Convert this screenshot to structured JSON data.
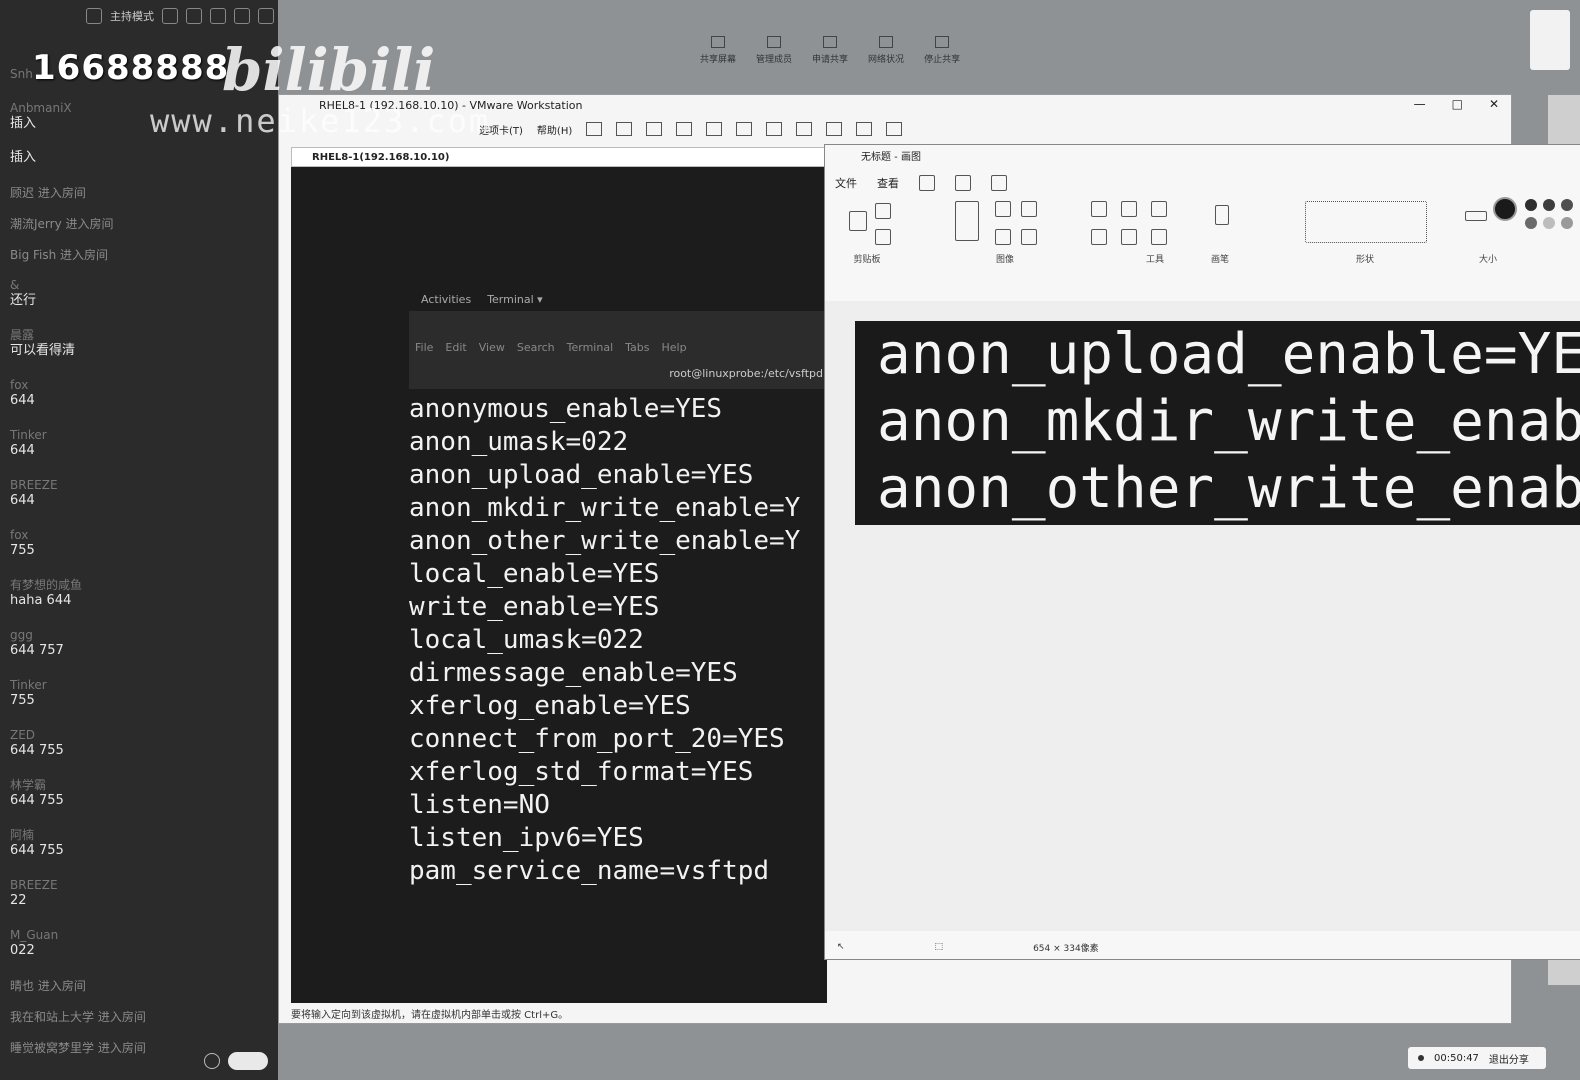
{
  "chat": {
    "top_label": "主持模式",
    "watermark_number": "16688888",
    "watermark_logo": "bilibili",
    "watermark_url": "www.neike123.com",
    "messages": [
      {
        "who": "Snh",
        "text": ""
      },
      {
        "who": "AnbmaniX",
        "text": "插入"
      },
      {
        "who": "",
        "text": "插入"
      },
      {
        "who": "",
        "text": "顾迟 进入房间",
        "system": true
      },
      {
        "who": "",
        "text": "潮流Jerry 进入房间",
        "system": true
      },
      {
        "who": "",
        "text": "Big Fish 进入房间",
        "system": true
      },
      {
        "who": "&",
        "text": "还行"
      },
      {
        "who": "晨露",
        "text": "可以看得清"
      },
      {
        "who": "fox",
        "text": "644"
      },
      {
        "who": "Tinker",
        "text": "644"
      },
      {
        "who": "BREEZE",
        "text": "644"
      },
      {
        "who": "fox",
        "text": "755"
      },
      {
        "who": "有梦想的咸鱼",
        "text": "haha 644"
      },
      {
        "who": "ggg",
        "text": "644 757"
      },
      {
        "who": "Tinker",
        "text": "755"
      },
      {
        "who": "ZED",
        "text": "644 755"
      },
      {
        "who": "林学霸",
        "text": "644  755"
      },
      {
        "who": "阿楠",
        "text": "644 755"
      },
      {
        "who": "BREEZE",
        "text": "22"
      },
      {
        "who": "M_Guan",
        "text": "022"
      },
      {
        "who": "",
        "text": "晴也 进入房间",
        "system": true
      },
      {
        "who": "",
        "text": "我在和站上大学 进入房间",
        "system": true
      },
      {
        "who": "",
        "text": "睡觉被窝梦里学 进入房间",
        "system": true
      }
    ]
  },
  "meeting_bar": {
    "items": [
      "共享屏幕",
      "管理成员",
      "申请共享",
      "网络状况",
      "停止共享"
    ]
  },
  "vmware": {
    "title": "RHEL8-1 (192.168.10.10) - VMware Workstation",
    "menus": [
      "选项卡(T)",
      "帮助(H)"
    ],
    "tab": "RHEL8-1(192.168.10.10)",
    "status": "要将输入定向到该虚拟机，请在虚拟机内部单击或按 Ctrl+G。",
    "window_controls": [
      "—",
      "□",
      "✕"
    ]
  },
  "guest": {
    "activities": "Activities",
    "terminal_menu": "Terminal ▾",
    "term_menus": [
      "File",
      "Edit",
      "View",
      "Search",
      "Terminal",
      "Tabs",
      "Help"
    ],
    "term_path": "root@linuxprobe:/etc/vsftpd",
    "config_lines": [
      "anonymous_enable=YES",
      "anon_umask=022",
      "anon_upload_enable=YES",
      "anon_mkdir_write_enable=Y",
      "anon_other_write_enable=Y",
      "local_enable=YES",
      "write_enable=YES",
      "local_umask=022",
      "dirmessage_enable=YES",
      "xferlog_enable=YES",
      "connect_from_port_20=YES",
      "xferlog_std_format=YES",
      "listen=NO",
      "listen_ipv6=YES",
      "pam_service_name=vsftpd"
    ]
  },
  "paint": {
    "title": "无标题 - 画图",
    "menus": [
      "文件",
      "查看"
    ],
    "groups": [
      "剪贴板",
      "图像",
      "工具",
      "画笔",
      "形状",
      "大小"
    ],
    "canvas_lines": [
      "anon_upload_enable=YE",
      "anon_mkdir_write_enab",
      "anon_other_write_enab"
    ],
    "status_size": "654 × 334像素",
    "colors": [
      "#1a1a1a",
      "#2e2e2e",
      "#3d3d3d",
      "#4f4f4f",
      "#6a6a6a",
      "#bdbdbd",
      "#9a9a9a",
      "#7a7a7a"
    ]
  },
  "timer": {
    "time": "00:50:47",
    "action": "退出分享"
  }
}
